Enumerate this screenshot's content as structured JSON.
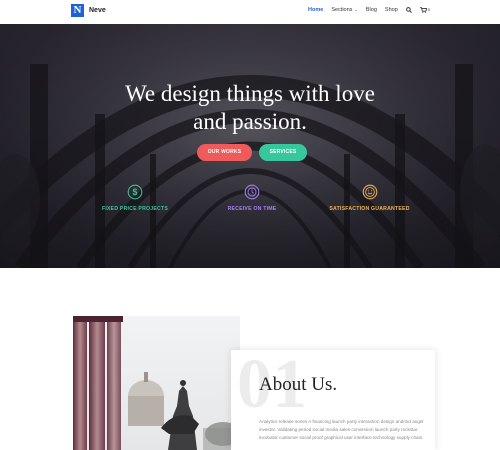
{
  "header": {
    "logo_letter": "N",
    "logo_text": "Neve",
    "nav": [
      {
        "label": "Home"
      },
      {
        "label": "Sections"
      },
      {
        "label": "Blog"
      },
      {
        "label": "Shop"
      }
    ],
    "cart_count": "0"
  },
  "hero": {
    "title_line1": "We design things with love",
    "title_line2": "and passion.",
    "buttons": [
      {
        "label": "OUR WORKS"
      },
      {
        "label": "SERVICES"
      }
    ],
    "features": [
      {
        "label": "FIXED PRICE PROJECTS",
        "icon": "dollar-circle-icon",
        "color": "#3ec39a"
      },
      {
        "label": "RECEIVE ON TIME",
        "icon": "clock-circle-icon",
        "color": "#a184f5"
      },
      {
        "label": "SATISFACTION GUARANTEED",
        "icon": "smile-circle-icon",
        "color": "#f0b15a"
      }
    ]
  },
  "about": {
    "number": "01",
    "title": "About Us.",
    "text": "Analytics release series A financing launch party interaction design android angel investor. Validating period social media sales conversion launch party rockstar incubator customer social proof graphical user interface technology supply chain."
  },
  "colors": {
    "accent": "#1d63d8",
    "works_button": "#ef5a5b",
    "services_button": "#38c69d"
  }
}
